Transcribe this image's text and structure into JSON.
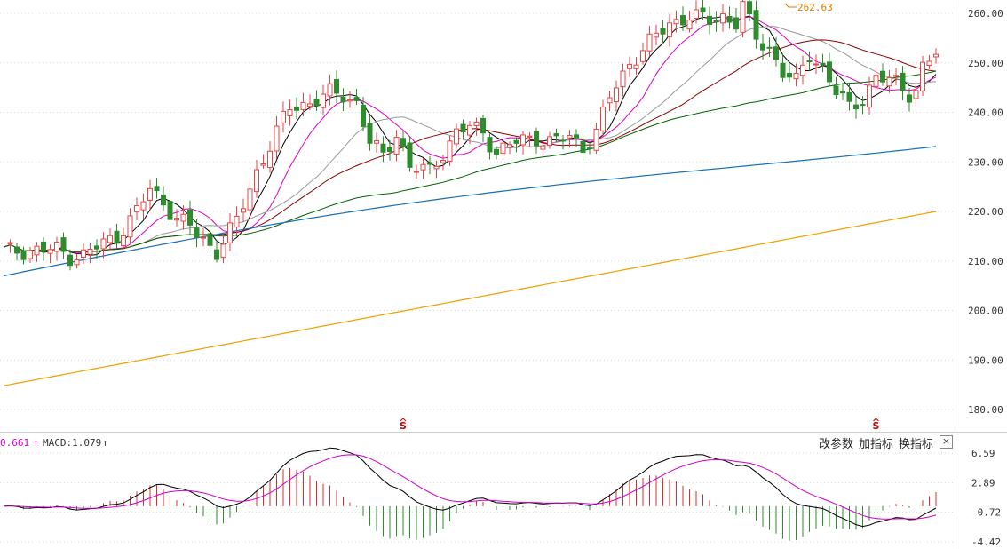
{
  "chart_data": [
    {
      "type": "candlestick",
      "title": "",
      "price_axis": {
        "ticks": [
          "260.00",
          "250.00",
          "240.00",
          "230.00",
          "220.00",
          "210.00",
          "200.00",
          "190.00",
          "180.00"
        ],
        "range": [
          175.5,
          266
        ]
      },
      "peak_annotation": "262.63",
      "signal_marks": [
        {
          "label": "S",
          "x_index": 60
        },
        {
          "label": "S",
          "x_index": 131
        }
      ],
      "colors": {
        "up": "#e64545",
        "down": "#2e8b2e",
        "ma1": "#000000",
        "ma2": "#e000c0",
        "ma3": "#999999",
        "ma4": "#8b0000",
        "ma5": "#006400",
        "ma6": "#1a6fb4",
        "ma7": "#f0a000"
      }
    },
    {
      "type": "macd",
      "header": {
        "dif_fragment": "0.661",
        "dif_arrow": "↑",
        "macd_text": "MACD:1.079",
        "macd_arrow": "↑"
      },
      "y_ticks": [
        "6.59",
        "2.89",
        "-0.72",
        "-4.42"
      ],
      "range": [
        -4.8,
        7.5
      ],
      "colors": {
        "dif": "#000000",
        "dea": "#d000c8",
        "pos": "#d03030",
        "neg": "#2e8b2e"
      }
    }
  ],
  "toolbar": {
    "btn1": "改参数",
    "btn2": "加指标",
    "btn3": "换指标",
    "close": "×"
  }
}
